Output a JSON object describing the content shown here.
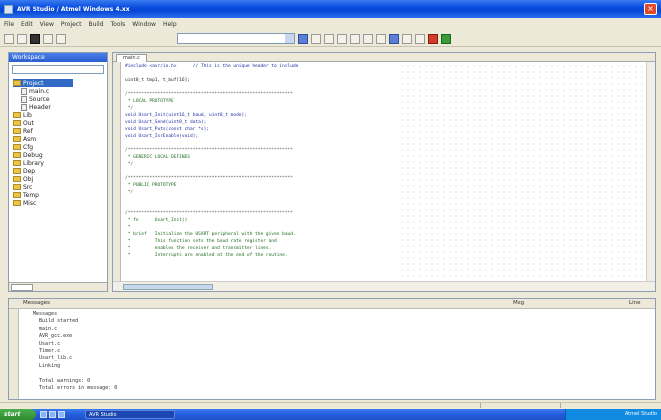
{
  "window": {
    "title": "AVR Studio / Atmel Windows 4.xx"
  },
  "menu": [
    "File",
    "Edit",
    "View",
    "Project",
    "Build",
    "Tools",
    "Window",
    "Help"
  ],
  "left_panel": {
    "header": "Workspace",
    "tree": [
      {
        "label": "Project",
        "type": "root",
        "selected": true
      },
      {
        "label": "main.c",
        "type": "file"
      },
      {
        "label": "Source",
        "type": "file"
      },
      {
        "label": "Header",
        "type": "file"
      },
      {
        "label": "Lib",
        "type": "folder"
      },
      {
        "label": "Out",
        "type": "folder"
      },
      {
        "label": "Ref",
        "type": "folder"
      },
      {
        "label": "Asm",
        "type": "folder"
      },
      {
        "label": "Cfg",
        "type": "folder"
      },
      {
        "label": "Debug",
        "type": "folder"
      },
      {
        "label": "Library",
        "type": "folder"
      },
      {
        "label": "Dep",
        "type": "folder"
      },
      {
        "label": "Obj",
        "type": "folder"
      },
      {
        "label": "Src",
        "type": "folder"
      },
      {
        "label": "Temp",
        "type": "folder"
      },
      {
        "label": "Misc",
        "type": "folder"
      }
    ]
  },
  "editor": {
    "tab": "main.c",
    "lines": [
      {
        "text": "#include <avr/io.h>      // This is the unique header to include",
        "style": "blue"
      },
      {
        "text": "",
        "style": ""
      },
      {
        "text": "uint8_t tmp1, t_buf[16];",
        "style": ""
      },
      {
        "text": "",
        "style": ""
      },
      {
        "text": "/*************************************************************",
        "style": "sep"
      },
      {
        "text": " * LOCAL PROTOTYPE",
        "style": "green"
      },
      {
        "text": " */",
        "style": "sep"
      },
      {
        "text": "void Usart_Init(uint16_t baud, uint8_t mode);",
        "style": "blue"
      },
      {
        "text": "void Usart_Send(uint8_t data);",
        "style": "blue"
      },
      {
        "text": "void Usart_Puts(const char *s);",
        "style": "blue"
      },
      {
        "text": "void Usart_IsrEnable(void);",
        "style": "blue"
      },
      {
        "text": "",
        "style": ""
      },
      {
        "text": "/*************************************************************",
        "style": "sep"
      },
      {
        "text": " * GENERIC LOCAL DEFINES",
        "style": "green"
      },
      {
        "text": " */",
        "style": "sep"
      },
      {
        "text": "",
        "style": ""
      },
      {
        "text": "/*************************************************************",
        "style": "sep"
      },
      {
        "text": " * PUBLIC PROTOTYPE",
        "style": "green"
      },
      {
        "text": " */",
        "style": "sep"
      },
      {
        "text": "",
        "style": ""
      },
      {
        "text": "",
        "style": ""
      },
      {
        "text": "/*************************************************************",
        "style": "sep"
      },
      {
        "text": " * fn      Usart_Init()",
        "style": "green"
      },
      {
        "text": " *",
        "style": "green"
      },
      {
        "text": " * brief   Initialize the USART peripheral with the given baud.",
        "style": "green"
      },
      {
        "text": " *         This function sets the baud rate register and",
        "style": "green"
      },
      {
        "text": " *         enables the receiver and transmitter lines.",
        "style": "green"
      },
      {
        "text": " *         Interrupts are enabled at the end of the routine.",
        "style": "green"
      }
    ]
  },
  "output": {
    "title": "Messages",
    "col_mid": "Msg",
    "col_right": "Line",
    "lines": [
      "Messages",
      "  Build started",
      "  main.c",
      "  AVR_gcc.exe",
      "  Usart.c",
      "  Timer.c",
      "  Usart_lib.c",
      "  Linking",
      "",
      "  Total warnings: 0",
      "  Total errors in message: 0"
    ]
  },
  "taskbar": {
    "start": "start",
    "task_label": "AVR Studio",
    "clock": "Atmel Studio"
  }
}
